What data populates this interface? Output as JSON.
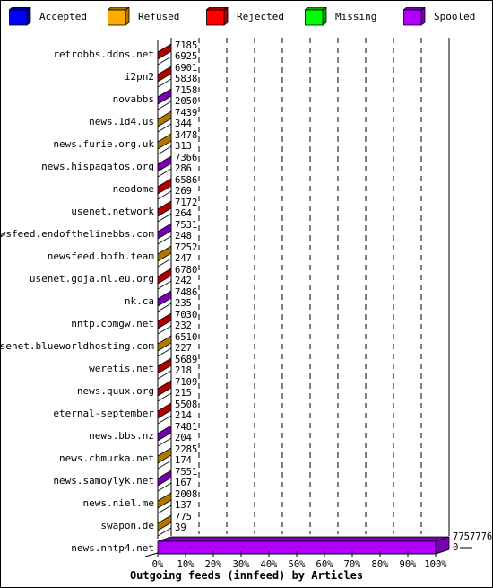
{
  "legend": [
    {
      "label": "Accepted",
      "color": "#0000ff",
      "side": "#00009f"
    },
    {
      "label": "Refused",
      "color": "#ffaa00",
      "side": "#af7700"
    },
    {
      "label": "Rejected",
      "color": "#ff0000",
      "side": "#af0000"
    },
    {
      "label": "Missing",
      "color": "#00ff00",
      "side": "#00af00"
    },
    {
      "label": "Spooled",
      "color": "#af00ff",
      "side": "#7700af"
    }
  ],
  "chart_data": {
    "type": "bar",
    "orientation": "horizontal",
    "stacked_percent": true,
    "title": "",
    "xlabel": "Outgoing feeds (innfeed) by Articles",
    "ylabel": "",
    "xlim": [
      0,
      100
    ],
    "x_ticks": [
      "0%",
      "10%",
      "20%",
      "30%",
      "40%",
      "50%",
      "60%",
      "70%",
      "80%",
      "90%",
      "100%"
    ],
    "grid": true,
    "legend_position": "top",
    "categories": [
      {
        "name": "retrobbs.ddns.net",
        "top_value": "7185",
        "bottom_value": "6925",
        "color": "#af0000"
      },
      {
        "name": "i2pn2",
        "top_value": "6901",
        "bottom_value": "5838",
        "color": "#af0000"
      },
      {
        "name": "novabbs",
        "top_value": "7158",
        "bottom_value": "2050",
        "color": "#7700af"
      },
      {
        "name": "news.1d4.us",
        "top_value": "7439",
        "bottom_value": "344",
        "color": "#af7700"
      },
      {
        "name": "news.furie.org.uk",
        "top_value": "3478",
        "bottom_value": "313",
        "color": "#af7700"
      },
      {
        "name": "news.hispagatos.org",
        "top_value": "7366",
        "bottom_value": "286",
        "color": "#7700af"
      },
      {
        "name": "neodome",
        "top_value": "6586",
        "bottom_value": "269",
        "color": "#af0000"
      },
      {
        "name": "usenet.network",
        "top_value": "7172",
        "bottom_value": "264",
        "color": "#af0000"
      },
      {
        "name": "newsfeed.endofthelinebbs.com",
        "top_value": "7531",
        "bottom_value": "248",
        "color": "#7700af"
      },
      {
        "name": "newsfeed.bofh.team",
        "top_value": "7252",
        "bottom_value": "247",
        "color": "#af7700"
      },
      {
        "name": "usenet.goja.nl.eu.org",
        "top_value": "6780",
        "bottom_value": "242",
        "color": "#af0000"
      },
      {
        "name": "nk.ca",
        "top_value": "7486",
        "bottom_value": "235",
        "color": "#7700af"
      },
      {
        "name": "nntp.comgw.net",
        "top_value": "7030",
        "bottom_value": "232",
        "color": "#af0000"
      },
      {
        "name": "usenet.blueworldhosting.com",
        "top_value": "6510",
        "bottom_value": "227",
        "color": "#af7700"
      },
      {
        "name": "weretis.net",
        "top_value": "5689",
        "bottom_value": "218",
        "color": "#af0000"
      },
      {
        "name": "news.quux.org",
        "top_value": "7109",
        "bottom_value": "215",
        "color": "#af0000"
      },
      {
        "name": "eternal-september",
        "top_value": "5508",
        "bottom_value": "214",
        "color": "#af0000"
      },
      {
        "name": "news.bbs.nz",
        "top_value": "7481",
        "bottom_value": "204",
        "color": "#7700af"
      },
      {
        "name": "news.chmurka.net",
        "top_value": "2285",
        "bottom_value": "174",
        "color": "#af7700"
      },
      {
        "name": "news.samoylyk.net",
        "top_value": "7551",
        "bottom_value": "167",
        "color": "#7700af"
      },
      {
        "name": "news.niel.me",
        "top_value": "2008",
        "bottom_value": "137",
        "color": "#af7700"
      },
      {
        "name": "swapon.de",
        "top_value": "775",
        "bottom_value": "39",
        "color": "#af7700"
      },
      {
        "name": "news.nntp4.net",
        "top_value": "7757776",
        "bottom_value": "0",
        "color": "#af00ff",
        "percent": 100
      }
    ]
  }
}
